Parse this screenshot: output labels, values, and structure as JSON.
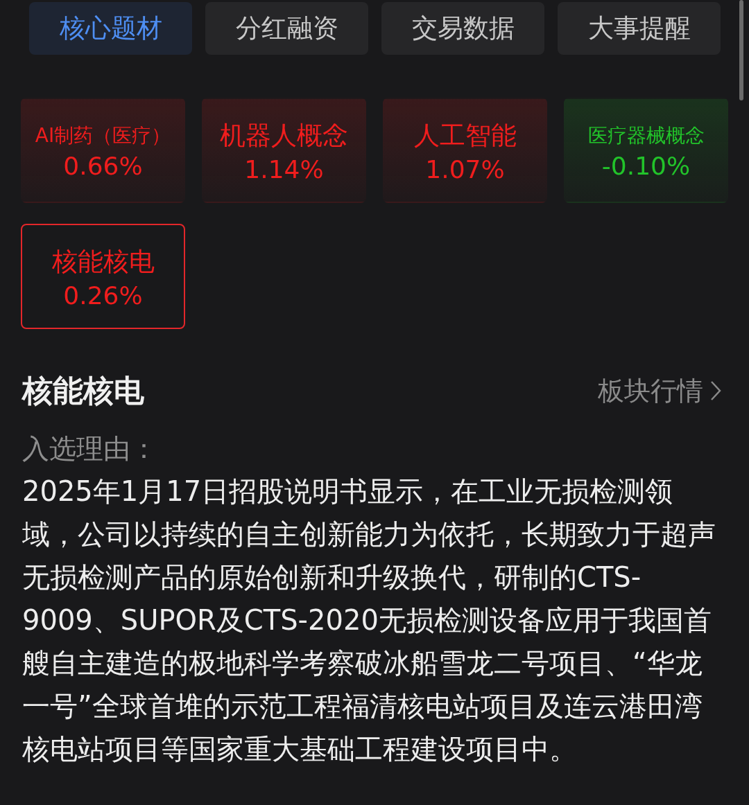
{
  "tabs": [
    {
      "label": "核心题材",
      "selected": true
    },
    {
      "label": "分红融资",
      "selected": false
    },
    {
      "label": "交易数据",
      "selected": false
    },
    {
      "label": "大事提醒",
      "selected": false
    }
  ],
  "concept_tiles": [
    {
      "name": "AI制药（医疗）",
      "change": "0.66%",
      "color": "#f01d1d",
      "selected": false
    },
    {
      "name": "机器人概念",
      "change": "1.14%",
      "color": "#f01d1d",
      "selected": false
    },
    {
      "name": "人工智能",
      "change": "1.07%",
      "color": "#f01d1d",
      "selected": false
    },
    {
      "name": "医疗器械概念",
      "change": "-0.10%",
      "color": "#22c32a",
      "selected": false
    },
    {
      "name": "核能核电",
      "change": "0.26%",
      "color": "#f01d1d",
      "selected": true
    }
  ],
  "detail": {
    "title": "核能核电",
    "link": "板块行情",
    "reason_label": "入选理由：",
    "reason_text": "2025年1月17日招股说明书显示，在工业无损检测领域，公司以持续的自主创新能力为依托，长期致力于超声无损检测产品的原始创新和升级换代，研制的CTS-9009、SUPOR及CTS-2020无损检测设备应用于我国首艘自主建造的极地科学考察破冰船雪龙二号项目、“华龙一号”全球首堆的示范工程福清核电站项目及连云港田湾核电站项目等国家重大基础工程建设项目中。"
  }
}
